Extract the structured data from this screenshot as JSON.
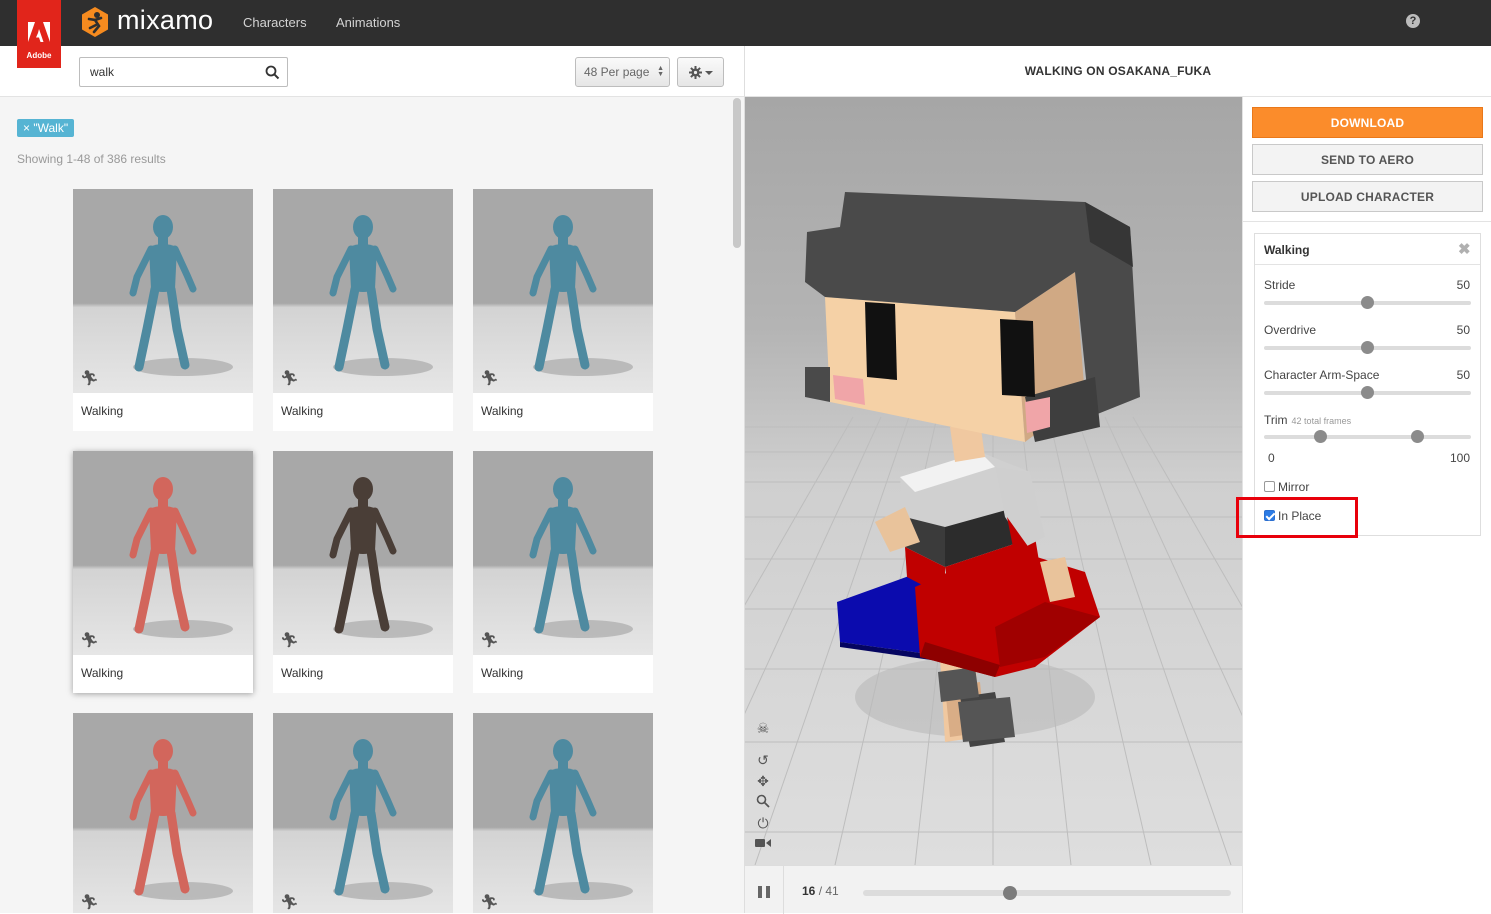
{
  "topbar": {
    "adobe_label": "Adobe",
    "logo_text": "mixamo",
    "nav": [
      {
        "label": "Characters"
      },
      {
        "label": "Animations"
      }
    ],
    "help_label": "?"
  },
  "search": {
    "value": "walk",
    "per_page": "48 Per page",
    "filter_tag": "× \"Walk\"",
    "result_count": "Showing 1-48 of 386 results"
  },
  "cards": [
    {
      "label": "Walking",
      "figure_color": "#4e8aa0"
    },
    {
      "label": "Walking",
      "figure_color": "#4e8aa0"
    },
    {
      "label": "Walking",
      "figure_color": "#4e8aa0"
    },
    {
      "label": "Walking",
      "figure_color": "#d2665c"
    },
    {
      "label": "Walking",
      "figure_color": "#4a3e37"
    },
    {
      "label": "Walking",
      "figure_color": "#4e8aa0"
    },
    {
      "label": "",
      "figure_color": "#d2665c"
    },
    {
      "label": "",
      "figure_color": "#4e8aa0"
    },
    {
      "label": "",
      "figure_color": "#4e8aa0"
    }
  ],
  "viewer": {
    "title": "WALKING ON OSAKANA_FUKA",
    "current_frame": "16",
    "total_frames": " / 41",
    "progress": 0.4
  },
  "actions": {
    "download": "DOWNLOAD",
    "send_to_aero": "SEND TO AERO",
    "upload_character": "UPLOAD CHARACTER"
  },
  "settings": {
    "title": "Walking",
    "stride": {
      "label": "Stride",
      "value": "50"
    },
    "overdrive": {
      "label": "Overdrive",
      "value": "50"
    },
    "arm_space": {
      "label": "Character Arm-Space",
      "value": "50"
    },
    "trim": {
      "label": "Trim",
      "sub": "42 total frames",
      "min": "0",
      "max": "100",
      "start": 0.27,
      "end": 0.74
    },
    "mirror": {
      "label": "Mirror",
      "checked": false
    },
    "in_place": {
      "label": "In Place",
      "checked": true
    }
  },
  "colors": {
    "accent_orange": "#fb8c2b",
    "adobe_red": "#e1251b",
    "tag_blue": "#56b4d3",
    "highlight_red": "#e8000b"
  }
}
